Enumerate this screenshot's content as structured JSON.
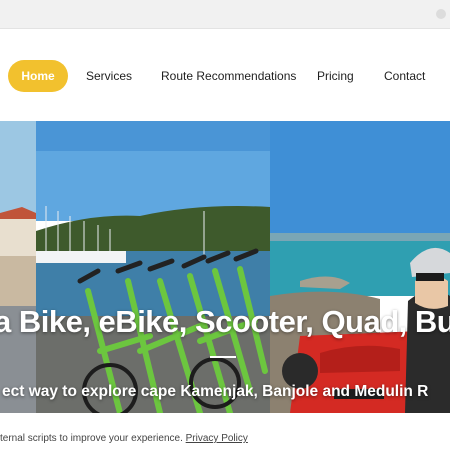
{
  "nav": {
    "items": [
      {
        "label": "Home",
        "active": true
      },
      {
        "label": "Services",
        "active": false
      },
      {
        "label": "Route Recommendations",
        "active": false
      },
      {
        "label": "Pricing",
        "active": false
      },
      {
        "label": "Contact",
        "active": false
      }
    ]
  },
  "hero": {
    "title": "a Bike, eBike, Scooter, Quad, Bu",
    "subtitle": "ect way to explore cape Kamenjak, Banjole and Medulin R"
  },
  "cookie": {
    "text": "ternal scripts to improve your experience. ",
    "link_label": "Privacy Policy"
  },
  "colors": {
    "accent": "#f2c12e",
    "bike_green": "#6cc63f",
    "quad_red": "#d42a23"
  }
}
